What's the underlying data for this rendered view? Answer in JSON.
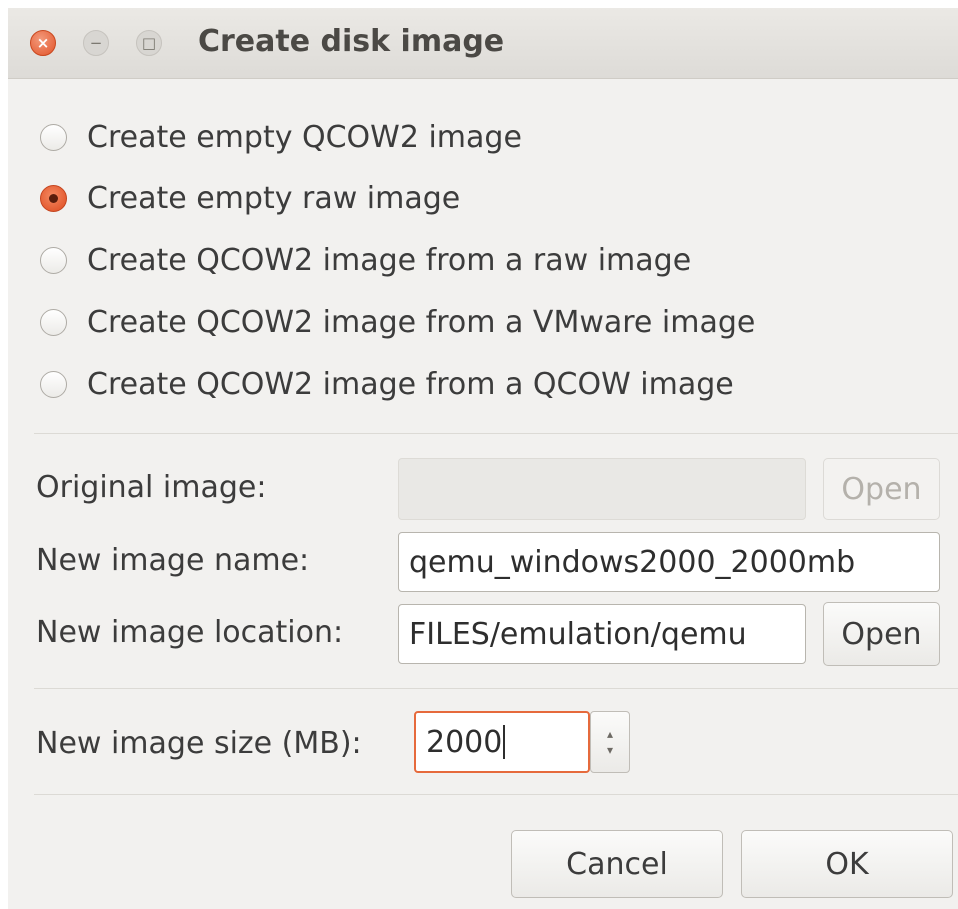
{
  "window": {
    "title": "Create disk image",
    "controls": {
      "close_glyph": "×",
      "minimize_glyph": "−",
      "maximize_glyph": "□"
    }
  },
  "radio_options": [
    {
      "label": "Create empty QCOW2 image",
      "selected": false
    },
    {
      "label": "Create empty raw image",
      "selected": true
    },
    {
      "label": "Create QCOW2 image from a raw image",
      "selected": false
    },
    {
      "label": "Create QCOW2 image from a VMware image",
      "selected": false
    },
    {
      "label": "Create QCOW2 image from a QCOW image",
      "selected": false
    }
  ],
  "original_image": {
    "label": "Original image:",
    "value": "",
    "open_label": "Open"
  },
  "new_image_name": {
    "label": "New image name:",
    "value": "qemu_windows2000_2000mb"
  },
  "new_image_location": {
    "label": "New image location:",
    "value": "FILES/emulation/qemu",
    "open_label": "Open"
  },
  "new_image_size": {
    "label": "New image size (MB):",
    "value": "2000",
    "up_glyph": "▴",
    "down_glyph": "▾"
  },
  "buttons": {
    "cancel": "Cancel",
    "ok": "OK"
  },
  "colors": {
    "accent": "#e2542a",
    "window_bg": "#f2f1ef",
    "titlebar_bg": "#e4e2de"
  }
}
